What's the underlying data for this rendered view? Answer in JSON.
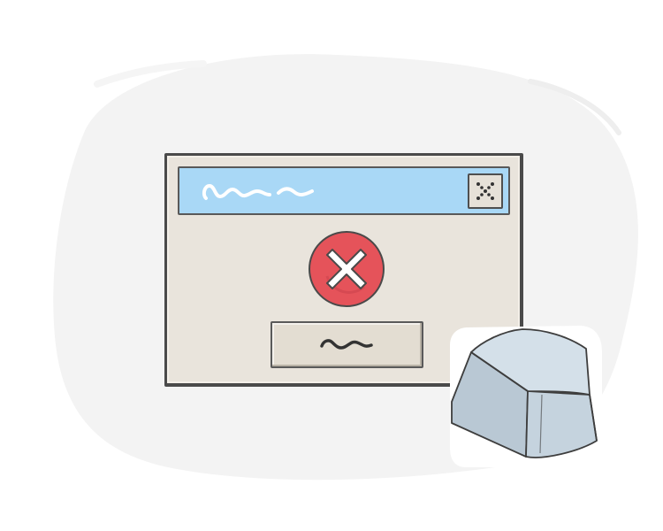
{
  "scene": {
    "background_color": "#ffffff",
    "blob_color": "#f3f3f3"
  },
  "dialog": {
    "window_color": "#e9e4dc",
    "titlebar_color": "#a9d8f6",
    "title_text": "",
    "close_icon": "close-icon",
    "error_icon": "error-x-circle-icon",
    "error_color": "#e5535a",
    "button_label": "",
    "button_icon": "squiggle-icon"
  },
  "keycap": {
    "icon": "keyboard-key-icon",
    "color": "#c9d6e0"
  }
}
